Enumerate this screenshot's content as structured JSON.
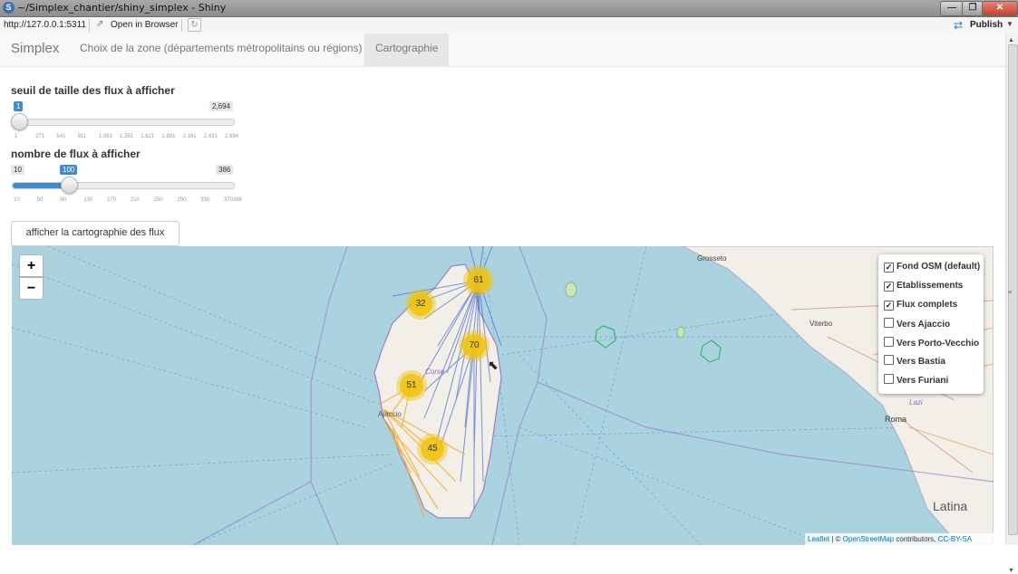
{
  "window": {
    "title": "~/Simplex_chantier/shiny_simplex - Shiny",
    "app_icon_letter": "S",
    "min_label": "—",
    "max_label": "❐",
    "close_label": "✕"
  },
  "addressbar": {
    "url": "http://127.0.0.1:5311",
    "open_in_browser": "Open in Browser",
    "publish": "Publish"
  },
  "navbar": {
    "brand": "Simplex",
    "tabs": [
      {
        "label": "Choix de la zone (départements métropolitains ou régions)",
        "active": false
      },
      {
        "label": "Cartographie",
        "active": true
      }
    ]
  },
  "slider1": {
    "label": "seuil de taille des flux à afficher",
    "min": 1,
    "max": 2694,
    "value": 1,
    "min_label": "1",
    "max_label": "2,694",
    "value_label": "1",
    "ticks": [
      "1",
      "271",
      "541",
      "811",
      "1,081",
      "1,351",
      "1,621",
      "1,891",
      "2,161",
      "2,431",
      "2,694"
    ]
  },
  "slider2": {
    "label": "nombre de flux à afficher",
    "min": 10,
    "max": 386,
    "value": 100,
    "min_label": "10",
    "max_label": "386",
    "value_label": "100",
    "ticks": [
      "10",
      "50",
      "90",
      "130",
      "170",
      "210",
      "250",
      "290",
      "330",
      "370386"
    ]
  },
  "button": {
    "label": "afficher la cartographie des flux"
  },
  "map": {
    "zoom_in": "+",
    "zoom_out": "−",
    "clusters": [
      "61",
      "32",
      "70",
      "51",
      "45"
    ],
    "place_labels": [
      "Grosseto",
      "Viterbo",
      "Roma",
      "Lazi",
      "Latina",
      "Corse",
      "Ajaccio"
    ],
    "layers": [
      {
        "label": "Fond OSM (default)",
        "checked": true
      },
      {
        "label": "Etablissements",
        "checked": true
      },
      {
        "label": "Flux complets",
        "checked": true
      },
      {
        "label": "Vers Ajaccio",
        "checked": false
      },
      {
        "label": "Vers Porto-Vecchio",
        "checked": false
      },
      {
        "label": "Vers Bastia",
        "checked": false
      },
      {
        "label": "Vers Furiani",
        "checked": false
      }
    ],
    "attribution": {
      "leaflet": "Leaflet",
      "sep": " | © ",
      "osm": "OpenStreetMap",
      "contrib": " contributors, ",
      "license": "CC-BY-SA"
    },
    "colors": {
      "sea": "#aad3df",
      "land": "#f2efe9",
      "cluster": "#f0c419",
      "flow_blue": "#4f6fcf",
      "flow_orange": "#f5a623",
      "boundary": "#9b7fc4"
    }
  }
}
